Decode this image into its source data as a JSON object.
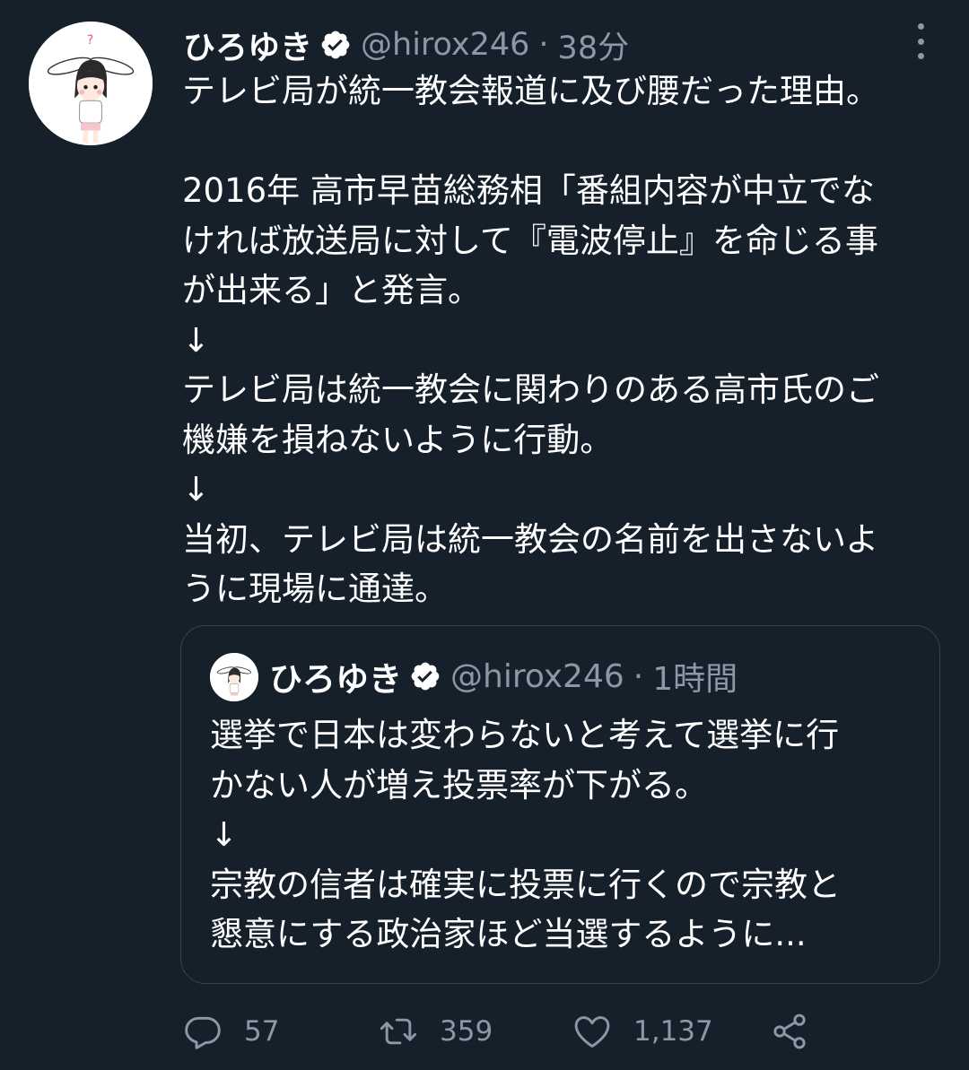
{
  "tweet": {
    "author": {
      "display_name": "ひろゆき",
      "handle": "@hirox246",
      "verified": true,
      "avatar_icon": "bunny-ear-girl-avatar"
    },
    "separator": "·",
    "time": "38分",
    "body_lines": [
      "テレビ局が統一教会報道に及び腰だった理由。",
      "",
      "2016年 高市早苗総務相「番組内容が中立でな",
      "ければ放送局に対して『電波停止』を命じる事",
      "が出来る」と発言。",
      "↓",
      "テレビ局は統一教会に関わりのある高市氏のご",
      "機嫌を損ねないように行動。",
      "↓",
      "当初、テレビ局は統一教会の名前を出さないよ",
      "うに現場に通達。"
    ]
  },
  "quoted_tweet": {
    "author": {
      "display_name": "ひろゆき",
      "handle": "@hirox246",
      "verified": true
    },
    "separator": "·",
    "time": "1時間",
    "body_lines": [
      "選挙で日本は変わらないと考えて選挙に行",
      "かない人が増え投票率が下がる。",
      "↓",
      "宗教の信者は確実に投票に行くので宗教と",
      "懇意にする政治家ほど当選するように..."
    ]
  },
  "actions": {
    "reply": {
      "icon": "reply-icon",
      "count": "57"
    },
    "retweet": {
      "icon": "retweet-icon",
      "count": "359"
    },
    "like": {
      "icon": "heart-icon",
      "count": "1,137"
    },
    "share": {
      "icon": "share-icon"
    }
  },
  "colors": {
    "background": "#15202b",
    "text": "#ffffff",
    "muted": "#8b98a5",
    "border": "#38444d"
  }
}
